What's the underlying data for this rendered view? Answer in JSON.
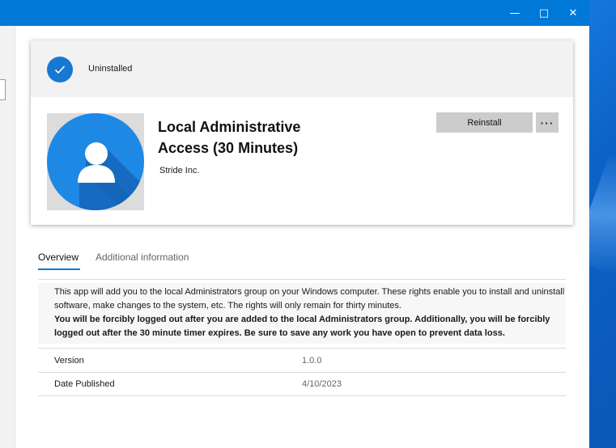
{
  "status": {
    "text": "Uninstalled",
    "icon": "checkmark-icon",
    "color": "#1778d2"
  },
  "window_controls": {
    "minimize": "—",
    "maximize": "□",
    "close": "✕"
  },
  "app": {
    "title": "Local Administrative Access (30 Minutes)",
    "publisher": "Stride Inc.",
    "icon": "user-icon",
    "icon_color": "#1e88e5"
  },
  "actions": {
    "reinstall_label": "Reinstall",
    "more_label": "···"
  },
  "tabs": [
    {
      "label": "Overview",
      "selected": true
    },
    {
      "label": "Additional information",
      "selected": false
    }
  ],
  "description": {
    "text": "This app will add you to the local Administrators group on your Windows computer. These rights enable you to install and uninstall software, make changes to the system, etc. The rights will only remain for thirty minutes.",
    "warning": "You will be forcibly logged out after you are added to the local Administrators group. Additionally, you will be forcibly logged out after the 30 minute timer expires. Be sure to save any work you have open to prevent data loss."
  },
  "details": [
    {
      "label": "Version",
      "value": "1.0.0"
    },
    {
      "label": "Date Published",
      "value": "4/10/2023"
    }
  ],
  "colors": {
    "accent": "#0078d7",
    "titlebar": "#0078d7",
    "button_bg": "#cccccc"
  }
}
